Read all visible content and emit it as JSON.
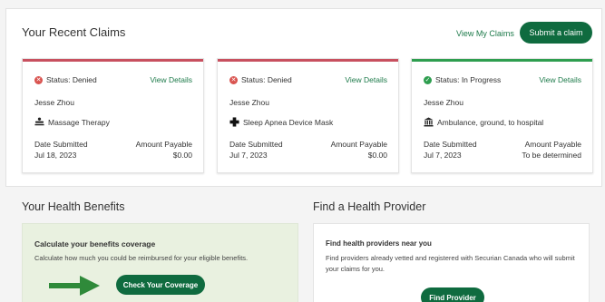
{
  "claims": {
    "title": "Your Recent Claims",
    "view_claims_label": "View My Claims",
    "submit_label": "Submit a claim",
    "date_label": "Date Submitted",
    "amount_label": "Amount Payable",
    "details_label": "View Details",
    "cards": [
      {
        "status": "Status: Denied",
        "status_color": "#d9534f",
        "stripe_color": "#c8505f",
        "status_icon": "x-circle-icon",
        "person": "Jesse Zhou",
        "service": "Massage Therapy",
        "service_icon": "massage-icon",
        "date": "Jul 18, 2023",
        "amount": "$0.00"
      },
      {
        "status": "Status: Denied",
        "status_color": "#d9534f",
        "stripe_color": "#c8505f",
        "status_icon": "x-circle-icon",
        "person": "Jesse Zhou",
        "service": "Sleep Apnea Device Mask",
        "service_icon": "medical-cross-icon",
        "date": "Jul 7, 2023",
        "amount": "$0.00"
      },
      {
        "status": "Status: In Progress",
        "status_color": "#2e9e4f",
        "stripe_color": "#2e9e4f",
        "status_icon": "check-circle-icon",
        "person": "Jesse Zhou",
        "service": "Ambulance, ground, to hospital",
        "service_icon": "hospital-icon",
        "date": "Jul 7, 2023",
        "amount": "To be determined"
      }
    ]
  },
  "benefits": {
    "title": "Your Health Benefits",
    "heading": "Calculate your benefits coverage",
    "desc": "Calculate how much you could be reimbursed for your eligible benefits.",
    "button_label": "Check Your Coverage"
  },
  "provider": {
    "title": "Find a Health Provider",
    "heading": "Find health providers near you",
    "desc": "Find providers already vetted and registered with Securian Canada who will submit your claims for you.",
    "button_label": "Find Provider"
  },
  "colors": {
    "brand_green": "#0f6b3f",
    "link_green": "#1d7a4a",
    "arrow_green": "#2f8a3a"
  }
}
